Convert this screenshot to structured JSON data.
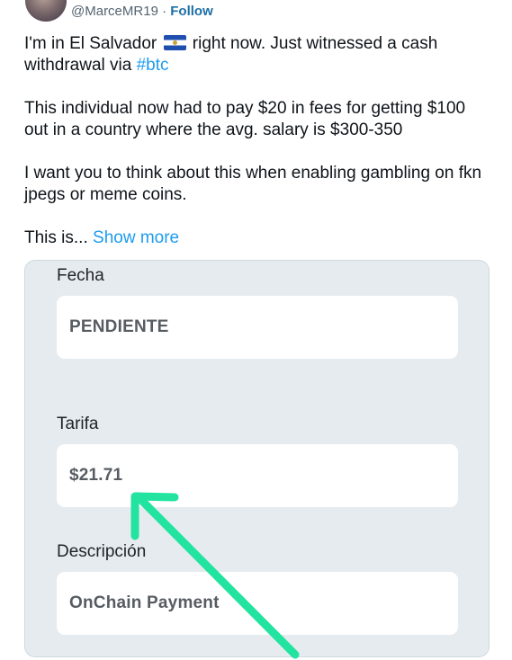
{
  "tweet": {
    "handle": "@MarceMR19",
    "separator": "·",
    "follow_label": "Follow",
    "paragraphs": {
      "p1_before_flag": "I'm in El Salvador",
      "p1_flag": "el-salvador-flag-icon",
      "p1_after_flag": " right now. Just witnessed a cash withdrawal via ",
      "p1_hashtag": "#btc",
      "p2": "This individual now had to pay $20 in fees for getting $100 out in a country where the avg. salary is $300-350",
      "p3": "I want you to think about this when enabling gambling on fkn jpegs or meme coins.",
      "p4": "This is...",
      "show_more": "Show more"
    }
  },
  "screenshot_card": {
    "fields": [
      {
        "label": "Fecha",
        "value": "PENDIENTE"
      },
      {
        "label": "Tarifa",
        "value": "$21.71"
      },
      {
        "label": "Descripción",
        "value": "OnChain Payment"
      }
    ],
    "arrow_color": "#22e3a0",
    "arrow_target": "Tarifa value"
  },
  "colors": {
    "link": "#1d9bf0",
    "follow": "#1d6fa5",
    "card_bg": "#e6ebef"
  }
}
